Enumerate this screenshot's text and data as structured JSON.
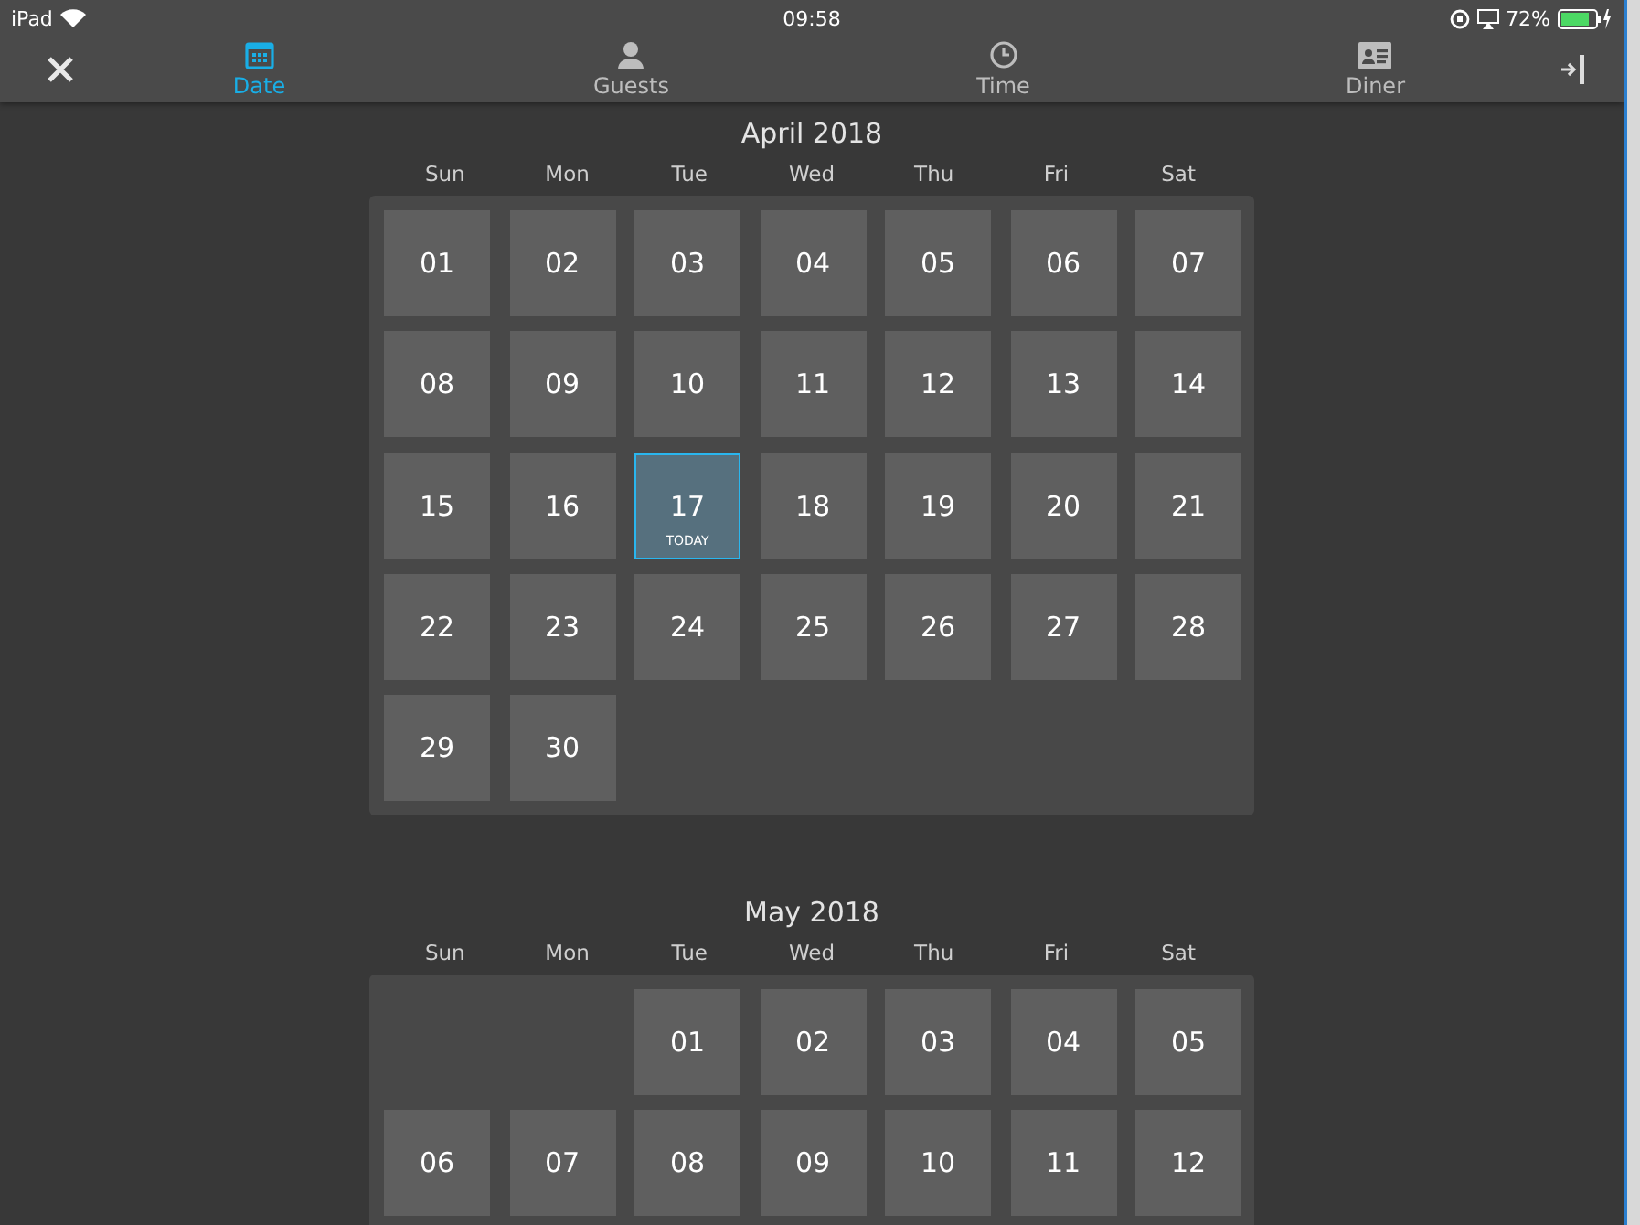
{
  "status_bar": {
    "device": "iPad",
    "time": "09:58",
    "battery": "72%"
  },
  "nav": {
    "tabs": [
      {
        "kind": "calendar",
        "label": "Date",
        "selected": true
      },
      {
        "kind": "person",
        "label": "Guests",
        "selected": false
      },
      {
        "kind": "clock",
        "label": "Time",
        "selected": false
      },
      {
        "kind": "card",
        "label": "Diner",
        "selected": false
      }
    ]
  },
  "months": [
    {
      "title": "April 2018",
      "weekdays": [
        "Sun",
        "Mon",
        "Tue",
        "Wed",
        "Thu",
        "Fri",
        "Sat"
      ],
      "days": [
        {
          "kind": "day",
          "label": "01",
          "today": false
        },
        {
          "kind": "day",
          "label": "02",
          "today": false
        },
        {
          "kind": "day",
          "label": "03",
          "today": false
        },
        {
          "kind": "day",
          "label": "04",
          "today": false
        },
        {
          "kind": "day",
          "label": "05",
          "today": false
        },
        {
          "kind": "day",
          "label": "06",
          "today": false
        },
        {
          "kind": "day",
          "label": "07",
          "today": false
        },
        {
          "kind": "day",
          "label": "08",
          "today": false
        },
        {
          "kind": "day",
          "label": "09",
          "today": false
        },
        {
          "kind": "day",
          "label": "10",
          "today": false
        },
        {
          "kind": "day",
          "label": "11",
          "today": false
        },
        {
          "kind": "day",
          "label": "12",
          "today": false
        },
        {
          "kind": "day",
          "label": "13",
          "today": false
        },
        {
          "kind": "day",
          "label": "14",
          "today": false
        },
        {
          "kind": "day",
          "label": "15",
          "today": false
        },
        {
          "kind": "day",
          "label": "16",
          "today": false
        },
        {
          "kind": "day",
          "label": "17",
          "today": true,
          "badge": "TODAY"
        },
        {
          "kind": "day",
          "label": "18",
          "today": false
        },
        {
          "kind": "day",
          "label": "19",
          "today": false
        },
        {
          "kind": "day",
          "label": "20",
          "today": false
        },
        {
          "kind": "day",
          "label": "21",
          "today": false
        },
        {
          "kind": "day",
          "label": "22",
          "today": false
        },
        {
          "kind": "day",
          "label": "23",
          "today": false
        },
        {
          "kind": "day",
          "label": "24",
          "today": false
        },
        {
          "kind": "day",
          "label": "25",
          "today": false
        },
        {
          "kind": "day",
          "label": "26",
          "today": false
        },
        {
          "kind": "day",
          "label": "27",
          "today": false
        },
        {
          "kind": "day",
          "label": "28",
          "today": false
        },
        {
          "kind": "day",
          "label": "29",
          "today": false
        },
        {
          "kind": "day",
          "label": "30",
          "today": false
        }
      ]
    },
    {
      "title": "May 2018",
      "weekdays": [
        "Sun",
        "Mon",
        "Tue",
        "Wed",
        "Thu",
        "Fri",
        "Sat"
      ],
      "days": [
        {
          "kind": "blank"
        },
        {
          "kind": "blank"
        },
        {
          "kind": "day",
          "label": "01",
          "today": false
        },
        {
          "kind": "day",
          "label": "02",
          "today": false
        },
        {
          "kind": "day",
          "label": "03",
          "today": false
        },
        {
          "kind": "day",
          "label": "04",
          "today": false
        },
        {
          "kind": "day",
          "label": "05",
          "today": false
        },
        {
          "kind": "day",
          "label": "06",
          "today": false
        },
        {
          "kind": "day",
          "label": "07",
          "today": false
        },
        {
          "kind": "day",
          "label": "08",
          "today": false
        },
        {
          "kind": "day",
          "label": "09",
          "today": false
        },
        {
          "kind": "day",
          "label": "10",
          "today": false
        },
        {
          "kind": "day",
          "label": "11",
          "today": false
        },
        {
          "kind": "day",
          "label": "12",
          "today": false
        }
      ]
    }
  ]
}
